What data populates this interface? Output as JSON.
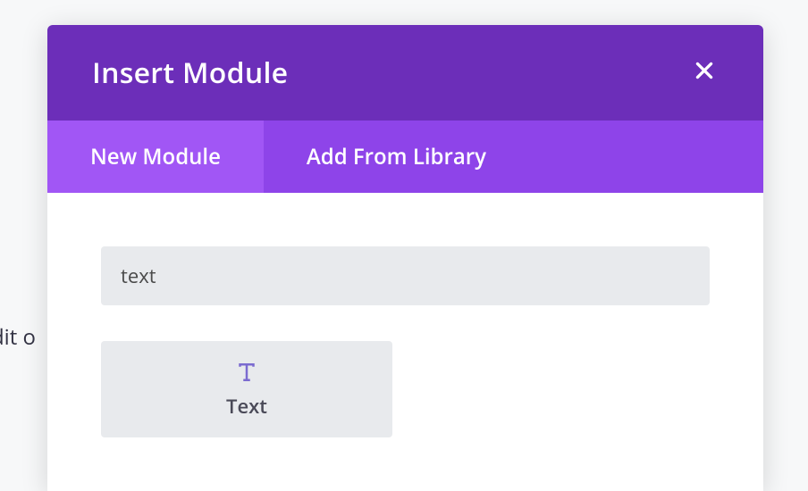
{
  "background": {
    "partial_text": "dit o"
  },
  "modal": {
    "title": "Insert Module",
    "tabs": {
      "new_module": "New Module",
      "add_from_library": "Add From Library"
    },
    "search": {
      "value": "text",
      "placeholder": ""
    },
    "modules": [
      {
        "label": "Text",
        "icon": "text-icon"
      }
    ]
  },
  "colors": {
    "header_bg": "#6c2eb9",
    "tab_bg": "#8e44e9",
    "tab_active_bg": "#a156f5",
    "input_bg": "#e8eaed",
    "module_icon": "#7b6bd0"
  }
}
